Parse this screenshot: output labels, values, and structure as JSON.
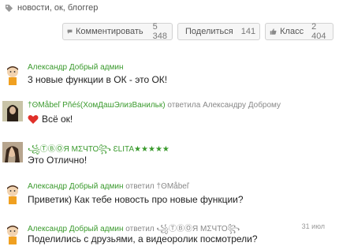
{
  "tags": {
    "text": "новости, ок, блоггер"
  },
  "actions": {
    "comment": {
      "label": "Комментировать",
      "count": "5 348"
    },
    "share": {
      "label": "Поделиться",
      "count": "141"
    },
    "klass": {
      "label": "Класс",
      "count": "2 404"
    }
  },
  "comments": [
    {
      "author": "Александр Добрый админ",
      "reply_info": "",
      "reply_target": "",
      "text": "3 новые функции в ОК - это ОК!",
      "date": ""
    },
    {
      "author": "†ꙨMåbeľ Pñéś(ХомДашЭлизВанильк)",
      "reply_info": "ответила",
      "reply_target": "Александру Доброму",
      "text": "Всё ок!",
      "date": ""
    },
    {
      "author": "꧁ⓉⒷⓄЯ МΣЧТО꧂ ƐLITA★★★★★",
      "reply_info": "",
      "reply_target": "",
      "text": "Это Отлично!",
      "date": ""
    },
    {
      "author": "Александр Добрый админ",
      "reply_info": "ответил",
      "reply_target": "†ꙨMåbeľ",
      "text": "Приветик) Как тебе новость про новые функции?",
      "date": ""
    },
    {
      "author": "Александр Добрый админ",
      "reply_info": "ответил",
      "reply_target": "꧁ⓉⒷⓄЯ МΣЧТО꧂",
      "text": "Поделились с друзьями, а видеоролик посмотрели?",
      "date": "31 июл"
    }
  ],
  "colors": {
    "author_green": "#3a9a2d",
    "heart_red": "#e0302a"
  }
}
